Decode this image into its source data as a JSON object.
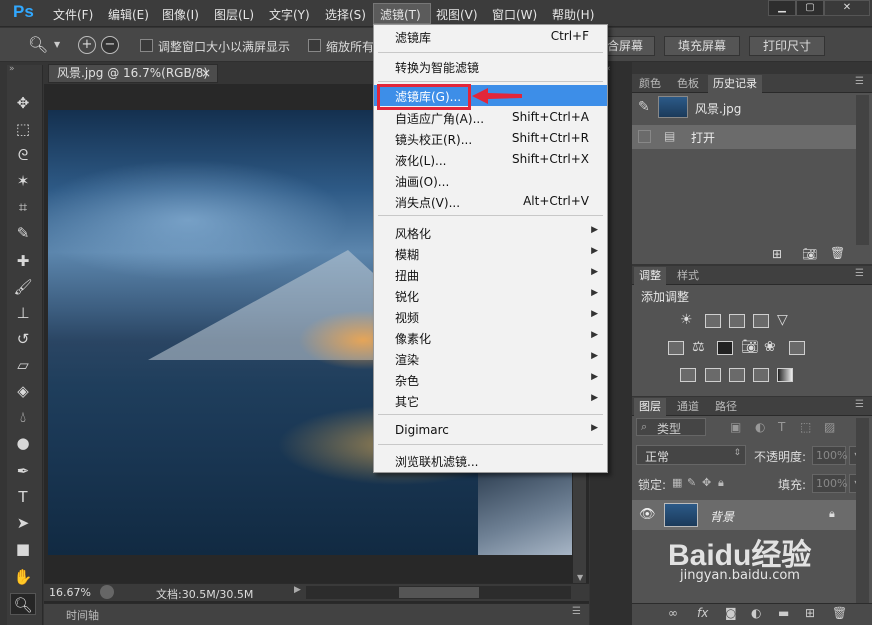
{
  "app": {
    "logo": "Ps"
  },
  "menubar": [
    "文件(F)",
    "编辑(E)",
    "图像(I)",
    "图层(L)",
    "文字(Y)",
    "选择(S)",
    "滤镜(T)",
    "视图(V)",
    "窗口(W)",
    "帮助(H)"
  ],
  "window_controls": [
    "minimize",
    "restore",
    "close"
  ],
  "options": {
    "resize_window": "调整窗口大小以满屏显示",
    "zoom_all": "缩放所有窗",
    "fit_screen": "合屏幕",
    "fill_screen": "填充屏幕",
    "print_size": "打印尺寸"
  },
  "document": {
    "tab": "风景.jpg @ 16.7%(RGB/8)",
    "tab_close": "×",
    "zoom": "16.67%",
    "doc_info": "文档:30.5M/30.5M",
    "timeline": "时间轴"
  },
  "filter_menu": {
    "items": [
      {
        "label": "滤镜库",
        "shortcut": "Ctrl+F"
      },
      {
        "label": "转换为智能滤镜",
        "shortcut": ""
      },
      {
        "label": "滤镜库(G)...",
        "shortcut": "",
        "highlighted": true
      },
      {
        "label": "自适应广角(A)...",
        "shortcut": "Shift+Ctrl+A"
      },
      {
        "label": "镜头校正(R)...",
        "shortcut": "Shift+Ctrl+R"
      },
      {
        "label": "液化(L)...",
        "shortcut": "Shift+Ctrl+X"
      },
      {
        "label": "油画(O)...",
        "shortcut": ""
      },
      {
        "label": "消失点(V)...",
        "shortcut": "Alt+Ctrl+V"
      },
      {
        "label": "风格化",
        "submenu": true
      },
      {
        "label": "模糊",
        "submenu": true
      },
      {
        "label": "扭曲",
        "submenu": true
      },
      {
        "label": "锐化",
        "submenu": true
      },
      {
        "label": "视频",
        "submenu": true
      },
      {
        "label": "像素化",
        "submenu": true
      },
      {
        "label": "渲染",
        "submenu": true
      },
      {
        "label": "杂色",
        "submenu": true
      },
      {
        "label": "其它",
        "submenu": true
      },
      {
        "label": "Digimarc",
        "submenu": true
      },
      {
        "label": "浏览联机滤镜..."
      }
    ]
  },
  "history_panel": {
    "tabs": [
      "颜色",
      "色板",
      "历史记录"
    ],
    "snapshot": "风景.jpg",
    "state": "打开"
  },
  "adjust_panel": {
    "tabs": [
      "调整",
      "样式"
    ],
    "title": "添加调整"
  },
  "layers_panel": {
    "tabs": [
      "图层",
      "通道",
      "路径"
    ],
    "filter_kind": "类型",
    "blend_mode": "正常",
    "opacity_label": "不透明度:",
    "opacity": "100%",
    "lock_label": "锁定:",
    "fill_label": "填充:",
    "fill": "100%",
    "layer_name": "背景"
  },
  "watermark": {
    "brand": "Baidu经验",
    "url": "jingyan.baidu.com"
  },
  "colors": {
    "accent": "#3d8ee8",
    "highlight_box": "#e2263a",
    "ps_blue": "#31a8ff"
  }
}
